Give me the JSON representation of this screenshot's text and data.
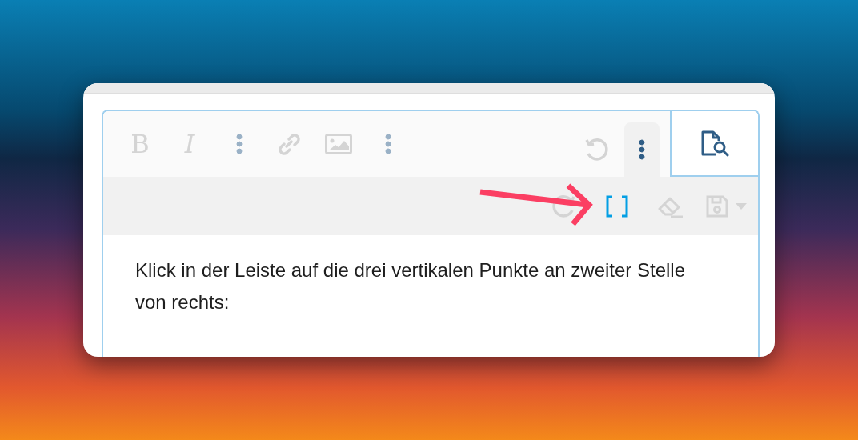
{
  "toolbar": {
    "items": [
      {
        "kind": "bold",
        "label": "B",
        "disabled": true
      },
      {
        "kind": "italic",
        "label": "I",
        "disabled": true
      },
      {
        "kind": "more",
        "disabled": false
      },
      {
        "kind": "link",
        "disabled": true
      },
      {
        "kind": "image",
        "disabled": true
      },
      {
        "kind": "more",
        "disabled": false
      }
    ],
    "right_items": [
      {
        "kind": "undo",
        "disabled": true,
        "selected": false
      },
      {
        "kind": "more",
        "disabled": false,
        "selected": true
      }
    ],
    "preview": {
      "kind": "preview"
    }
  },
  "secondary_toolbar": {
    "items": [
      {
        "kind": "redo",
        "disabled": true
      },
      {
        "kind": "brackets",
        "disabled": false
      },
      {
        "kind": "eraser",
        "disabled": true
      },
      {
        "kind": "save",
        "disabled": true
      }
    ]
  },
  "content": {
    "text": "Klick in der Leiste auf die drei vertikalen Punkte an zweiter Stelle von rechts:"
  },
  "annotation": {
    "kind": "arrow"
  }
}
